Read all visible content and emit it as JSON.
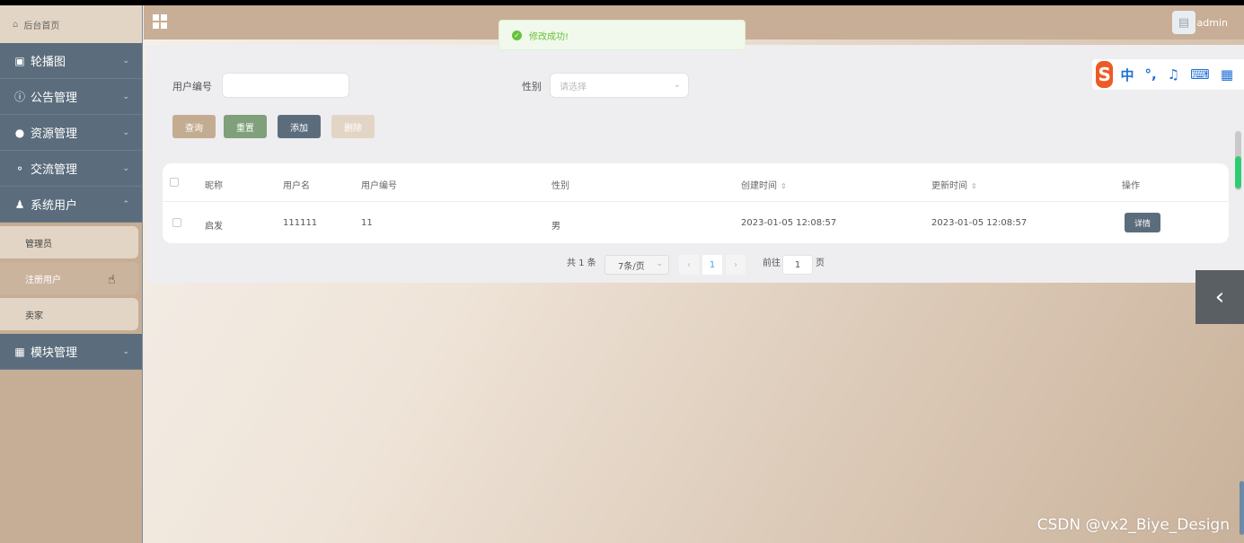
{
  "sidebar": {
    "home": {
      "label": "后台首页",
      "icon": "home-icon"
    },
    "items": [
      {
        "label": "轮播图",
        "icon": "image-icon",
        "expanded": false
      },
      {
        "label": "公告管理",
        "icon": "info-icon",
        "expanded": false
      },
      {
        "label": "资源管理",
        "icon": "bulb-icon",
        "expanded": false
      },
      {
        "label": "交流管理",
        "icon": "chat-icon",
        "expanded": false
      },
      {
        "label": "系统用户",
        "icon": "user-icon",
        "expanded": true,
        "children": [
          {
            "label": "管理员"
          },
          {
            "label": "注册用户",
            "active": true
          },
          {
            "label": "卖家"
          }
        ]
      },
      {
        "label": "模块管理",
        "icon": "grid-icon",
        "expanded": false
      }
    ]
  },
  "header": {
    "title": "",
    "user": "admin"
  },
  "toast": {
    "message": "修改成功!"
  },
  "search": {
    "user_no_label": "用户编号",
    "user_no_value": "",
    "gender_label": "性别",
    "gender_placeholder": "请选择"
  },
  "buttons": {
    "query": "查询",
    "reset": "重置",
    "add": "添加",
    "delete": "删除"
  },
  "table": {
    "columns": [
      "昵称",
      "用户名",
      "用户编号",
      "性别",
      "创建时间",
      "更新时间",
      "操作"
    ],
    "rows": [
      {
        "nickname": "启发",
        "username": "111111",
        "user_no": "11",
        "gender": "男",
        "created": "2023-01-05 12:08:57",
        "updated": "2023-01-05 12:08:57",
        "action": "详情"
      }
    ]
  },
  "pagination": {
    "total": "共 1 条",
    "page_size": "7条/页",
    "current_page": "1",
    "goto_label": "前往",
    "goto_value": "1",
    "page_suffix": "页"
  },
  "ime": {
    "labels": [
      "中",
      "°,"
    ]
  },
  "watermark": "CSDN @vx2_Biye_Design",
  "colors": {
    "sidebar_menu": "#5b6d7c",
    "header": "#c8ae96",
    "query_btn": "#c4ac93",
    "reset_btn": "#7fa07a",
    "add_btn": "#5b6d7c",
    "delete_btn": "#e3d5c5",
    "toast_text": "#67c23a"
  }
}
